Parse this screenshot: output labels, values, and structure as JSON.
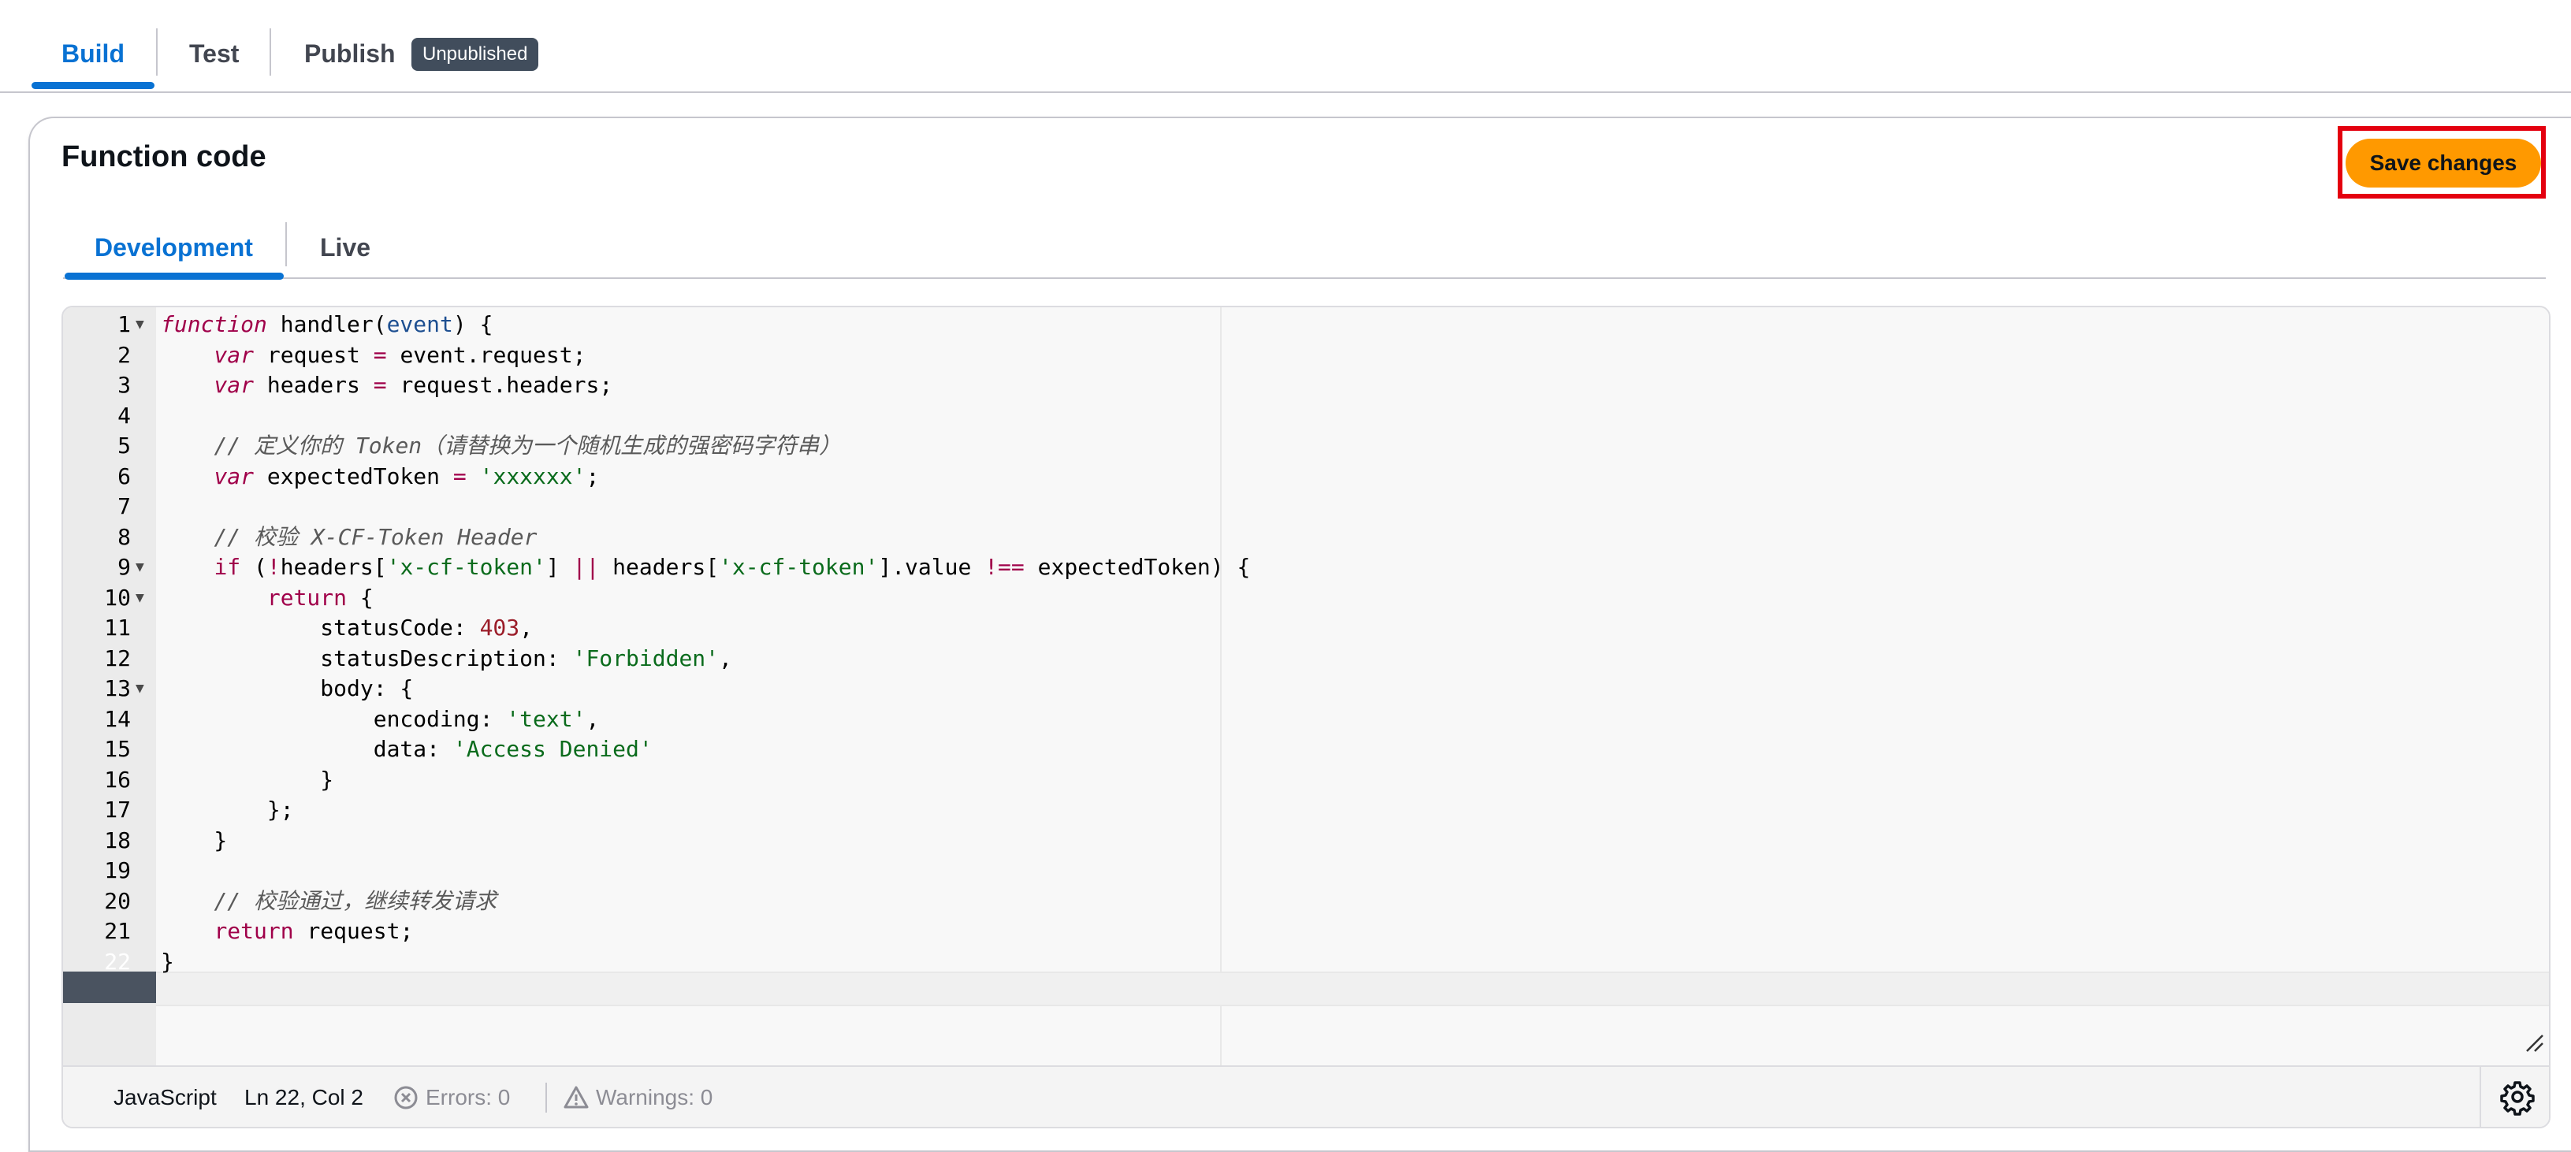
{
  "top_tabs": [
    {
      "label": "Build",
      "active": true
    },
    {
      "label": "Test",
      "active": false
    },
    {
      "label": "Publish",
      "active": false
    }
  ],
  "publish_badge": "Unpublished",
  "panel": {
    "title": "Function code",
    "save_label": "Save changes"
  },
  "inner_tabs": [
    {
      "label": "Development",
      "active": true
    },
    {
      "label": "Live",
      "active": false
    }
  ],
  "editor": {
    "active_line": 22,
    "line_numbers": [
      "1",
      "2",
      "3",
      "4",
      "5",
      "6",
      "7",
      "8",
      "9",
      "10",
      "11",
      "12",
      "13",
      "14",
      "15",
      "16",
      "17",
      "18",
      "19",
      "20",
      "21",
      "22"
    ],
    "foldable_lines": [
      1,
      9,
      10,
      13
    ],
    "lines": [
      "function handler(event) {",
      "    var request = event.request;",
      "    var headers = request.headers;",
      "",
      "    // 定义你的 Token（请替换为一个随机生成的强密码字符串）",
      "    var expectedToken = 'xxxxxx';",
      "",
      "    // 校验 X-CF-Token Header",
      "    if (!headers['x-cf-token'] || headers['x-cf-token'].value !== expectedToken) {",
      "        return {",
      "            statusCode: 403,",
      "            statusDescription: 'Forbidden',",
      "            body: {",
      "                encoding: 'text',",
      "                data: 'Access Denied'",
      "            }",
      "        };",
      "    }",
      "",
      "    // 校验通过，继续转发请求",
      "    return request;",
      "}"
    ]
  },
  "status_bar": {
    "language": "JavaScript",
    "cursor": "Ln 22, Col 2",
    "errors": "Errors: 0",
    "warnings": "Warnings: 0"
  },
  "colors": {
    "accent": "#0972d3",
    "save_button": "#ff9900",
    "highlight_box": "#e4000f",
    "keyword": "#a0004a",
    "string": "#0a6b1c",
    "number": "#9b1d29"
  },
  "icons": {
    "errors": "x-circle-icon",
    "warnings": "warning-triangle-icon",
    "settings": "gear-icon",
    "fold": "fold-arrow-icon",
    "resize": "resize-handle-icon"
  }
}
